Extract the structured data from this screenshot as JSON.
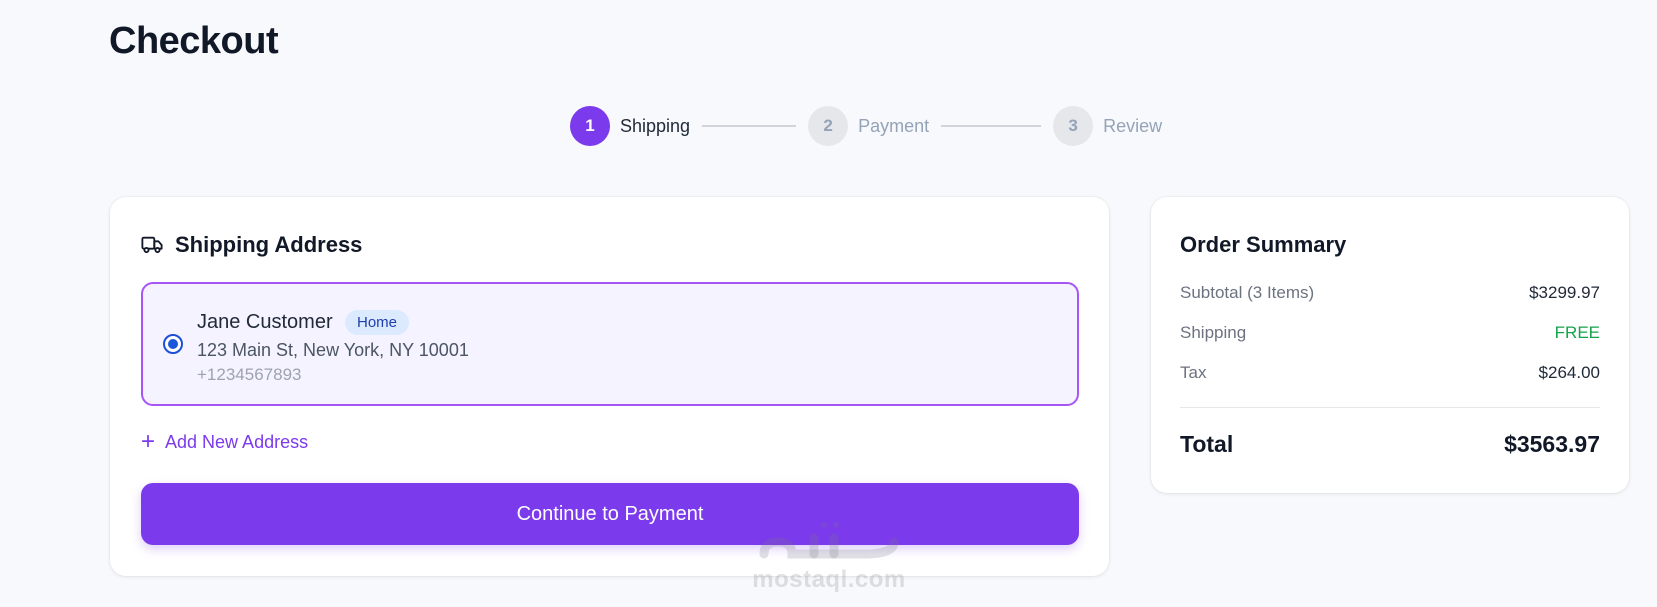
{
  "page": {
    "title": "Checkout"
  },
  "stepper": {
    "steps": [
      {
        "number": "1",
        "label": "Shipping",
        "state": "active"
      },
      {
        "number": "2",
        "label": "Payment",
        "state": "inactive"
      },
      {
        "number": "3",
        "label": "Review",
        "state": "inactive"
      }
    ]
  },
  "shipping": {
    "title": "Shipping Address",
    "icon": "truck-icon",
    "address": {
      "selected": true,
      "name": "Jane Customer",
      "badge": "Home",
      "line": "123 Main St, New York, NY 10001",
      "phone": "+1234567893"
    },
    "add_address_label": "Add New Address",
    "continue_label": "Continue to Payment"
  },
  "summary": {
    "title": "Order Summary",
    "subtotal_label": "Subtotal (3 Items)",
    "subtotal_value": "$3299.97",
    "shipping_label": "Shipping",
    "shipping_value": "FREE",
    "tax_label": "Tax",
    "tax_value": "$264.00",
    "total_label": "Total",
    "total_value": "$3563.97"
  },
  "watermark": {
    "brand": "mostaql.com"
  },
  "colors": {
    "accent": "#7c3aed",
    "accent_soft": "#f5f3ff",
    "free": "#16a34a",
    "badge_bg": "#dbeafe",
    "badge_text": "#1e40af"
  }
}
